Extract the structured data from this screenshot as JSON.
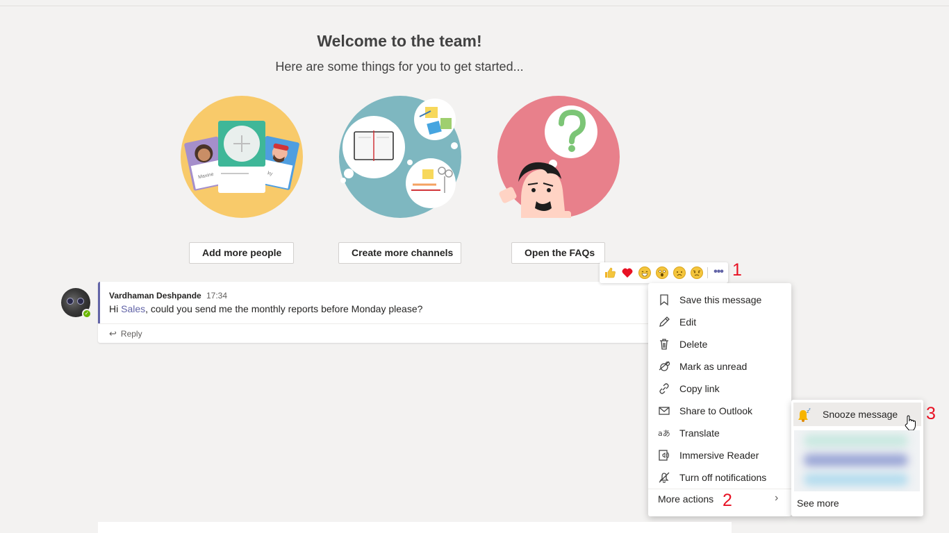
{
  "welcome": {
    "title": "Welcome to the team!",
    "subtitle": "Here are some things for you to get started..."
  },
  "actions": {
    "add_people": "Add more people",
    "create_channels": "Create more channels",
    "open_faqs": "Open the FAQs"
  },
  "illustration_labels": {
    "card_left_name": "Maxine",
    "card_right_name": "ky"
  },
  "message": {
    "author": "Vardhaman Deshpande",
    "time": "17:34",
    "text_before": "Hi ",
    "mention": "Sales",
    "text_after": ", could you send me the monthly reports before Monday please?",
    "reply_label": "Reply",
    "avatar_status": "available"
  },
  "reactions": [
    "like",
    "heart",
    "laugh",
    "surprised",
    "sad",
    "angry"
  ],
  "context_menu": {
    "items": [
      {
        "label": "Save this message",
        "icon": "bookmark-icon"
      },
      {
        "label": "Edit",
        "icon": "pencil-icon"
      },
      {
        "label": "Delete",
        "icon": "trash-icon"
      },
      {
        "label": "Mark as unread",
        "icon": "unread-icon"
      },
      {
        "label": "Copy link",
        "icon": "link-icon"
      },
      {
        "label": "Share to Outlook",
        "icon": "mail-icon"
      },
      {
        "label": "Translate",
        "icon": "translate-icon"
      },
      {
        "label": "Immersive Reader",
        "icon": "reader-icon"
      },
      {
        "label": "Turn off notifications",
        "icon": "bell-off-icon"
      }
    ],
    "more_actions": "More actions"
  },
  "submenu": {
    "snooze": "Snooze message",
    "see_more": "See more"
  },
  "step_markers": [
    "1",
    "2",
    "3"
  ],
  "colors": {
    "accent": "#6264a7",
    "step_marker": "#e81123",
    "presence": "#6bb700",
    "background": "#f3f2f1"
  }
}
